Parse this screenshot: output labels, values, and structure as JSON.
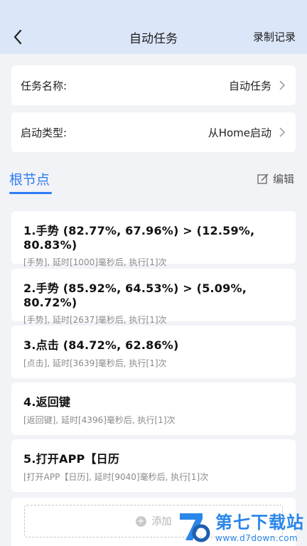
{
  "header": {
    "title": "自动任务",
    "action": "录制记录"
  },
  "settings": {
    "name_label": "任务名称:",
    "name_value": "自动任务",
    "start_label": "启动类型:",
    "start_value": "从Home启动"
  },
  "section": {
    "title": "根节点",
    "edit": "编辑"
  },
  "tasks": [
    {
      "title": "1.手势 (82.77%, 67.96%) > (12.59%, 80.83%)",
      "desc": "[手势], 延时[1000]毫秒后, 执行[1]次"
    },
    {
      "title": "2.手势 (85.92%, 64.53%) > (5.09%, 80.72%)",
      "desc": "[手势], 延时[2637]毫秒后, 执行[1]次"
    },
    {
      "title": "3.点击 (84.72%, 62.86%)",
      "desc": "[点击], 延时[3639]毫秒后, 执行[1]次"
    },
    {
      "title": "4.返回键",
      "desc": "[返回键], 延时[4396]毫秒后, 执行[1]次"
    },
    {
      "title": "5.打开APP【日历",
      "desc": "[打开APP【日历], 延时[9040]毫秒后, 执行[1]次"
    }
  ],
  "add": {
    "label": "添加"
  },
  "watermark": {
    "main": "第七下载站",
    "sub": "www.d7down.com"
  },
  "colors": {
    "header_bg": "#dbe6f8",
    "accent": "#2e7cf6",
    "background": "#f2f3f7"
  }
}
